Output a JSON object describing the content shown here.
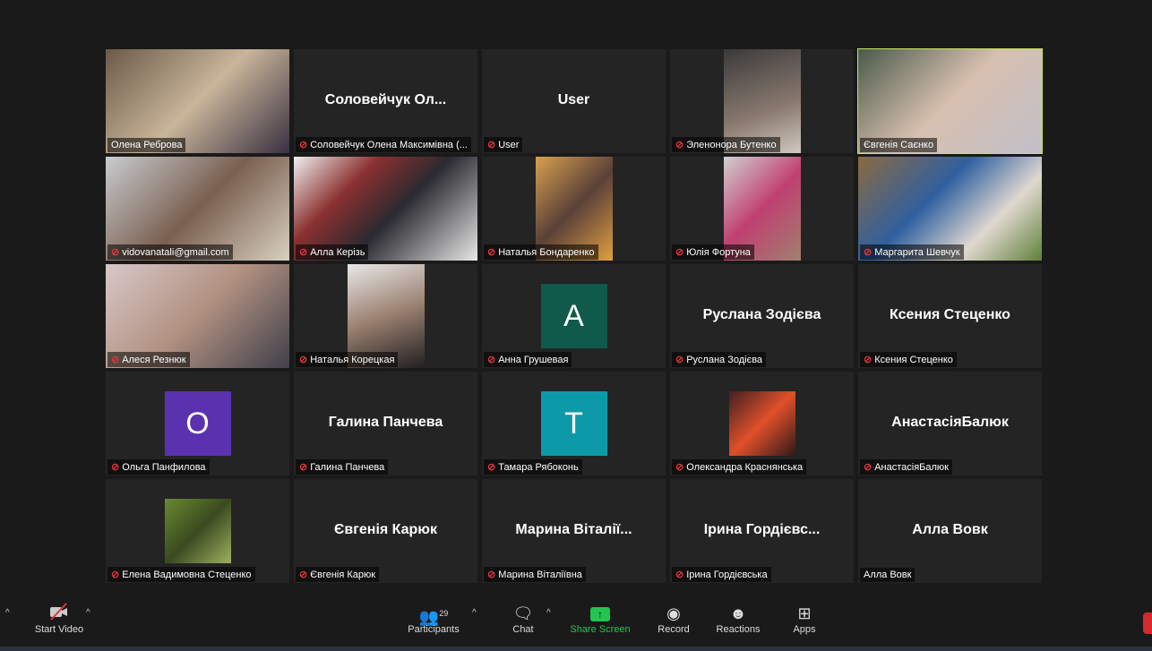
{
  "tiles": [
    {
      "name": "Олена Реброва",
      "type": "video",
      "muted": false,
      "bg": "linear-gradient(135deg,#6b5a48,#c8b59a 50%,#3a3040)",
      "fit": "full"
    },
    {
      "name": "Соловейчук Олена Максимівна (...",
      "big": "Соловейчук  Ол...",
      "type": "name",
      "muted": true
    },
    {
      "name": "User",
      "big": "User",
      "type": "name",
      "muted": true
    },
    {
      "name": "Эленонора Бутенко",
      "type": "video",
      "muted": true,
      "bg": "linear-gradient(160deg,#3a3a3a,#8a7a70 60%,#d0c8c0)",
      "fit": "narrow"
    },
    {
      "name": "Євгенія Саєнко",
      "type": "video",
      "muted": false,
      "bg": "linear-gradient(135deg,#4a5a4a,#d8c0b0 50%,#c0c0c8)",
      "fit": "full",
      "active": true
    },
    {
      "name": "vidovanatali@gmail.com",
      "type": "video",
      "muted": true,
      "bg": "linear-gradient(135deg,#c8ccd0,#7a6050 50%,#d8d0c0)",
      "fit": "full"
    },
    {
      "name": "Алла Керізь",
      "type": "video",
      "muted": true,
      "bg": "linear-gradient(135deg,#f0f0f0,#8a3030 30%,#2a2a30 55%,#e8e8e8)",
      "fit": "full"
    },
    {
      "name": "Наталья Бондаренко",
      "type": "video",
      "muted": true,
      "bg": "linear-gradient(135deg,#d8a050,#5a4038 50%,#e0a040)",
      "fit": "narrow"
    },
    {
      "name": "Юлія Фортуна",
      "type": "video",
      "muted": true,
      "bg": "linear-gradient(135deg,#d0d0d0,#c04070 50%,#a08070)",
      "fit": "narrow"
    },
    {
      "name": "Маргарита Шевчук",
      "type": "video",
      "muted": true,
      "bg": "linear-gradient(135deg,#8a6a40,#3060a0 40%,#e0d8d0 70%,#60803a)",
      "fit": "full"
    },
    {
      "name": "Алеся Резнюк",
      "type": "video",
      "muted": true,
      "bg": "linear-gradient(135deg,#d8c8c8,#b09080 50%,#40404a)",
      "fit": "full"
    },
    {
      "name": "Наталья Корецкая",
      "type": "video",
      "muted": true,
      "bg": "linear-gradient(160deg,#e8e8e8,#9a8070 50%,#202020)",
      "fit": "narrow"
    },
    {
      "name": "Анна Грушевая",
      "type": "avatar",
      "letter": "A",
      "color": "#0f5a4a",
      "muted": true
    },
    {
      "name": "Руслана Зодієва",
      "big": "Руслана Зодієва",
      "type": "name",
      "muted": true
    },
    {
      "name": "Ксения Стеценко",
      "big": "Ксения Стеценко",
      "type": "name",
      "muted": true
    },
    {
      "name": "Ольга Панфилова",
      "type": "avatar",
      "letter": "O",
      "color": "#5a32b0",
      "muted": true
    },
    {
      "name": "Галина Панчева",
      "big": "Галина Панчева",
      "type": "name",
      "muted": true
    },
    {
      "name": "Тамара Рябоконь",
      "type": "avatar",
      "letter": "T",
      "color": "#0d9aa8",
      "muted": true
    },
    {
      "name": "Олександра Краснянська",
      "type": "video",
      "muted": true,
      "bg": "linear-gradient(135deg,#402020,#e0502a 50%,#301818)",
      "fit": "small"
    },
    {
      "name": "АнастасіяБалюк",
      "big": "АнастасіяБалюк",
      "type": "name",
      "muted": true
    },
    {
      "name": "Елена Вадимовна Стеценко",
      "type": "video",
      "muted": true,
      "bg": "linear-gradient(135deg,#6a8a30,#3a4a20 50%,#a0b060)",
      "fit": "small"
    },
    {
      "name": "Євгенія Карюк",
      "big": "Євгенія Карюк",
      "type": "name",
      "muted": true
    },
    {
      "name": "Марина Віталіївна",
      "big": "Марина  Віталії...",
      "type": "name",
      "muted": true
    },
    {
      "name": "Ірина Гордієвська",
      "big": "Ірина  Гордієвс...",
      "type": "name",
      "muted": true
    },
    {
      "name": "Алла Вовк",
      "big": "Алла Вовк",
      "type": "name",
      "muted": false
    }
  ],
  "toolbar": {
    "start_video": "Start Video",
    "participants": "Participants",
    "participants_count": "29",
    "chat": "Chat",
    "share_screen": "Share Screen",
    "record": "Record",
    "reactions": "Reactions",
    "apps": "Apps",
    "share_color": "#23c552"
  }
}
